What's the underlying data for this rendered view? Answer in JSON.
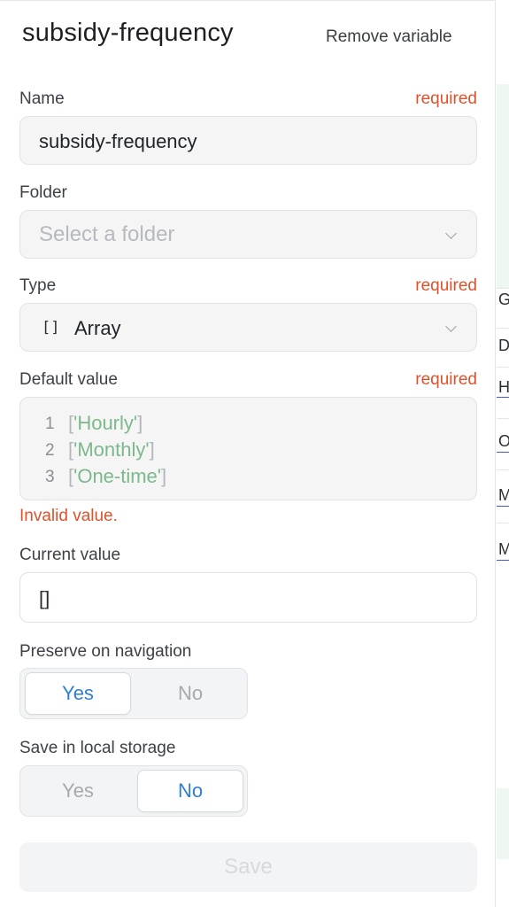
{
  "panel": {
    "title": "subsidy-frequency",
    "remove_label": "Remove variable"
  },
  "name_field": {
    "label": "Name",
    "required": "required",
    "value": "subsidy-frequency"
  },
  "folder_field": {
    "label": "Folder",
    "placeholder": "Select a folder",
    "icon": "chevron-down-icon"
  },
  "type_field": {
    "label": "Type",
    "required": "required",
    "icon_glyph": "[]",
    "value": "Array",
    "icon": "chevron-down-icon"
  },
  "default_field": {
    "label": "Default value",
    "required": "required",
    "lines": [
      {
        "num": "1",
        "value": "'Hourly'"
      },
      {
        "num": "2",
        "value": "'Monthly'"
      },
      {
        "num": "3",
        "value": "'One-time'"
      }
    ],
    "error": "Invalid value."
  },
  "current_field": {
    "label": "Current value",
    "value": "[]"
  },
  "preserve": {
    "label": "Preserve on navigation",
    "options": [
      "Yes",
      "No"
    ],
    "selected": "Yes"
  },
  "local_storage": {
    "label": "Save in local storage",
    "options": [
      "Yes",
      "No"
    ],
    "selected": "No"
  },
  "save_label": "Save",
  "side_fragments": [
    "G",
    "D",
    "Ho",
    "Or",
    "Mo",
    "Mo"
  ],
  "colors": {
    "required": "#e0502a",
    "accent": "#2f7fd1",
    "string": "#7cb98a"
  }
}
